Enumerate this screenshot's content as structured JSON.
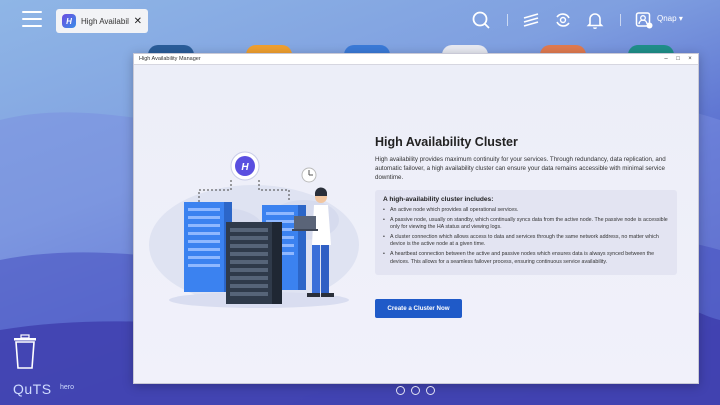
{
  "taskbar": {
    "tab": {
      "label": "High Availabili...",
      "icon": "ha-app-icon",
      "icon_glyph": "H"
    },
    "user_label": "Qnap"
  },
  "window": {
    "title": "High Availability Manager",
    "controls": {
      "minimize": "–",
      "maximize": "□",
      "close": "×"
    }
  },
  "main": {
    "title": "High Availability Cluster",
    "description": "High availability provides maximum continuity for your services. Through redundancy, data replication, and automatic failover, a high availability cluster can ensure your data remains accessible with minimal service downtime.",
    "info_heading": "A high-availability cluster includes:",
    "info_items": [
      "An active node which provides all operational services.",
      "A passive node, usually on standby, which continually syncs data from the active node. The passive node is accessible only for viewing the HA status and viewing logs.",
      "A cluster connection which allows access to data and services through the same network address, no matter which device is the active node at a given time.",
      "A heartbeat connection between the active and passive nodes which ensures data is always synced between the devices. This allows for a seamless failover process, ensuring continuous service availability."
    ],
    "create_button": "Create a Cluster Now"
  },
  "desktop": {
    "brand": "QuTS",
    "brand_suffix": "hero"
  },
  "colors": {
    "accent": "#1f5ac8",
    "window_bg": "#eeeef8",
    "server_blue": "#3b82f0",
    "server_dark": "#2f3a4a"
  }
}
